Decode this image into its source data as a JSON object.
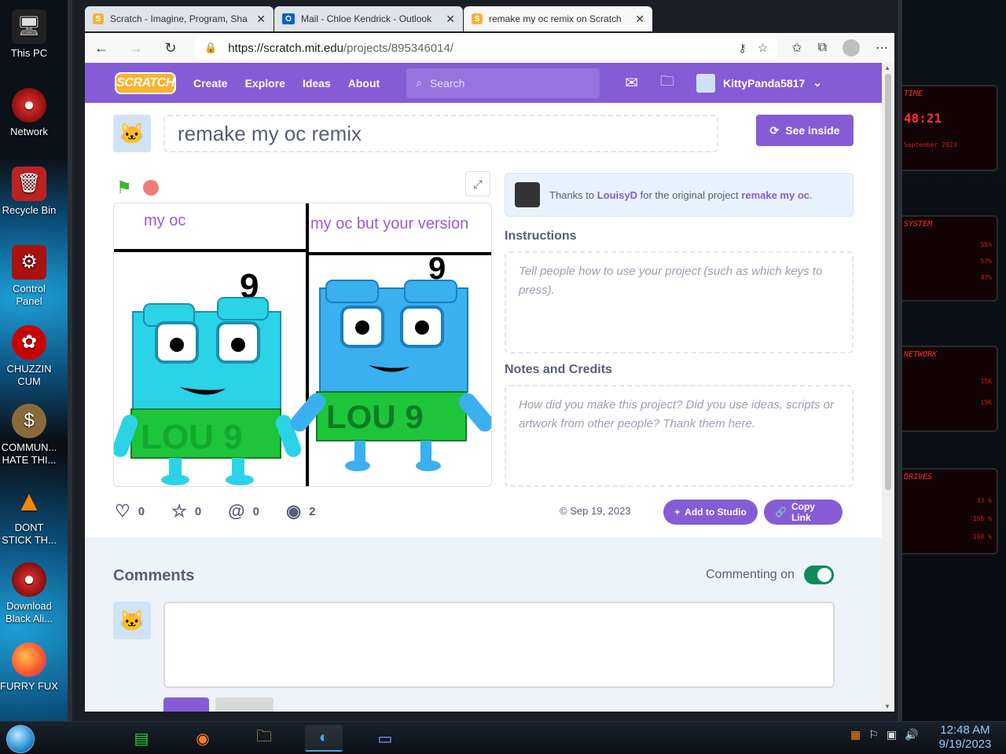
{
  "desktop": {
    "icons": [
      {
        "label": "This PC",
        "icon": "computer-icon"
      },
      {
        "label": "Network",
        "icon": "network-icon"
      },
      {
        "label": "Recycle Bin",
        "icon": "recycle-bin-icon"
      },
      {
        "label": "Control Panel",
        "icon": "control-panel-icon"
      },
      {
        "label": "CHUZZIN CUM",
        "icon": "shortcut-icon"
      },
      {
        "label": "COMMUN... HATE THI...",
        "icon": "money-bag-icon"
      },
      {
        "label": "DONT STICK TH...",
        "icon": "traffic-cone-icon"
      },
      {
        "label": "Download Black Ali...",
        "icon": "alien-icon"
      },
      {
        "label": "FURRY FUX",
        "icon": "firefox-icon"
      }
    ],
    "widgets": {
      "time_label": "TIME",
      "time_value": "48:21",
      "date_value": "September 2023",
      "system_label": "SYSTEM",
      "system_pcts": [
        "55%",
        "57%",
        "47%"
      ],
      "network_label": "NETWORK",
      "network_vals": [
        "15K",
        "15K"
      ],
      "drives_label": "DRIVES",
      "drives_pcts": [
        "33 %",
        "168 %",
        "168 %"
      ]
    }
  },
  "browser": {
    "tabs": [
      {
        "label": "Scratch - Imagine, Program, Sha",
        "icon": "scratch-favicon",
        "active": false
      },
      {
        "label": "Mail - Chloe Kendrick - Outlook",
        "icon": "outlook-favicon",
        "active": false
      },
      {
        "label": "remake my oc remix on Scratch",
        "icon": "scratch-favicon",
        "active": true
      }
    ],
    "close_glyph": "✕",
    "url_host": "https://scratch.mit.edu",
    "url_path": "/projects/895346014/"
  },
  "scratch": {
    "logo": "SCRATCH",
    "nav": {
      "create": "Create",
      "explore": "Explore",
      "ideas": "Ideas",
      "about": "About"
    },
    "search_placeholder": "Search",
    "username": "KittyPanda5817",
    "project_title": "remake my oc remix",
    "see_inside": "See inside",
    "stage": {
      "left_caption": "my oc",
      "right_caption": "my oc but your version",
      "left_number": "9",
      "right_number": "9",
      "left_sign": "LOU 9",
      "right_sign": "LOU 9"
    },
    "credits": {
      "prefix": "Thanks to",
      "author": "LouisyD",
      "middle": "for the original project",
      "original": "remake my oc",
      "suffix": "."
    },
    "instructions_heading": "Instructions",
    "instructions_placeholder": "Tell people how to use your project (such as which keys to press).",
    "notes_heading": "Notes and Credits",
    "notes_placeholder": "How did you make this project? Did you use ideas, scripts or artwork from other people? Thank them here.",
    "stats": {
      "loves": "0",
      "favorites": "0",
      "remixes": "0",
      "views": "2"
    },
    "date": "Sep 19, 2023",
    "add_to_studio": "Add to Studio",
    "copy_link": "Copy Link",
    "comments_heading": "Comments",
    "commenting_label": "Commenting on"
  },
  "taskbar": {
    "time": "12:48 AM",
    "date": "9/19/2023"
  }
}
